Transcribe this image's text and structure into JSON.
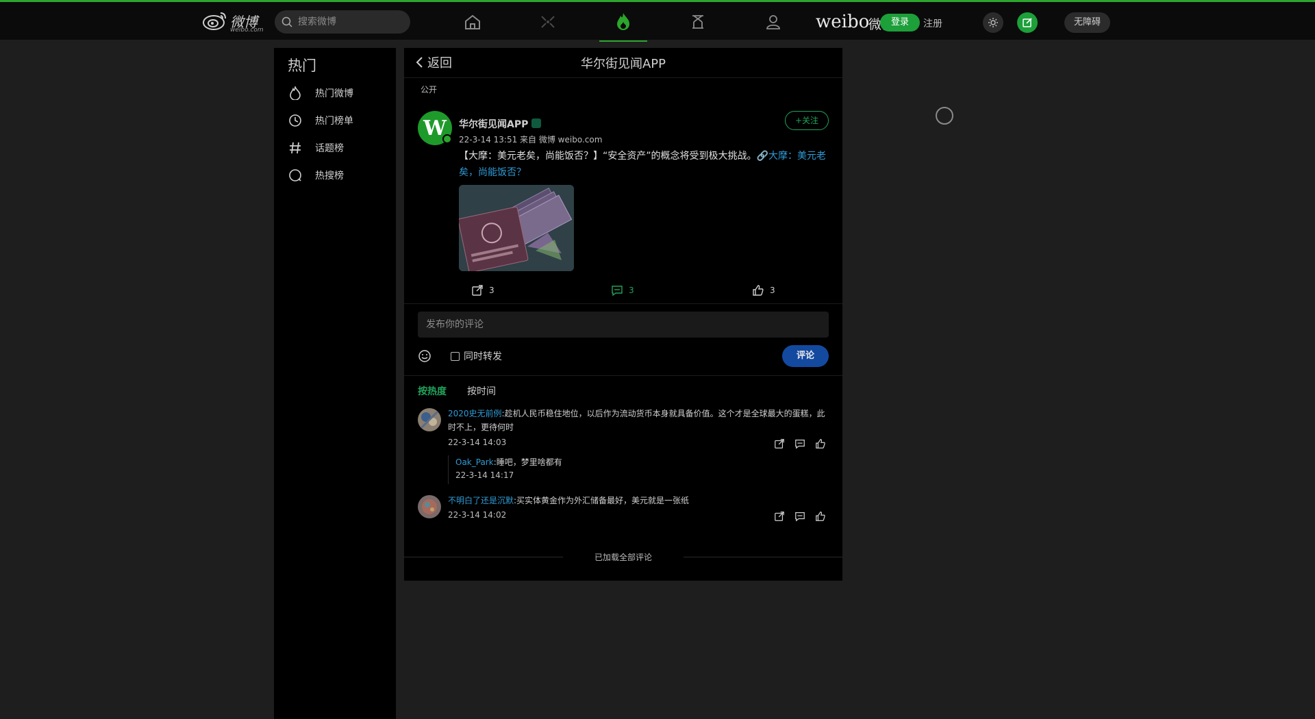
{
  "header": {
    "logo_text": "微博",
    "logo_sub": "weibo.com",
    "search_placeholder": "搜索微博",
    "nav_icons": [
      "home-icon",
      "video-icon",
      "hot-icon",
      "game-icon",
      "profile-icon"
    ],
    "weibo_word": "weibo",
    "weibo_cn": "微博",
    "login_label": "登录",
    "register_label": "注册",
    "accessibility_label": "无障碍",
    "accent_color": "#2ca52c"
  },
  "sidebar": {
    "title": "热门",
    "items": [
      {
        "label": "热门微博",
        "icon": "flame-icon"
      },
      {
        "label": "热门榜单",
        "icon": "clock-icon"
      },
      {
        "label": "话题榜",
        "icon": "hash-icon"
      },
      {
        "label": "热搜榜",
        "icon": "search-circle-icon"
      }
    ]
  },
  "main": {
    "back_label": "返回",
    "page_title": "华尔街见闻APP",
    "visibility": "公开",
    "post": {
      "author": "华尔街见闻APP",
      "avatar_letter": "W",
      "meta": "22-3-14 13:51  来自 微博 weibo.com",
      "follow_label": "+关注",
      "text": "【大摩：美元老矣，尚能饭否？】“安全资产”的概念将受到极大挑战。",
      "link_text": "🔗大摩：美元老矣，尚能饭否？",
      "repost_count": "3",
      "comment_count": "3",
      "like_count": "3"
    },
    "comment_box": {
      "placeholder": "发布你的评论",
      "repost_label": "同时转发",
      "submit_label": "评论"
    },
    "sort_tabs": [
      "按热度",
      "按时间"
    ],
    "comments": [
      {
        "user": "2020史无前例",
        "text": ":趁机人民币稳住地位，以后作为流动货币本身就具备价值。这个才是全球最大的蛋糕，此时不上，更待何时",
        "time": "22-3-14 14:03",
        "reply": {
          "user": "Oak_Park",
          "text": ":睡吧，梦里啥都有",
          "time": "22-3-14 14:17"
        }
      },
      {
        "user": "不明白了还是沉默",
        "text": ":买实体黄金作为外汇储备最好，美元就是一张纸",
        "time": "22-3-14 14:02"
      }
    ],
    "end_text": "已加载全部评论"
  }
}
